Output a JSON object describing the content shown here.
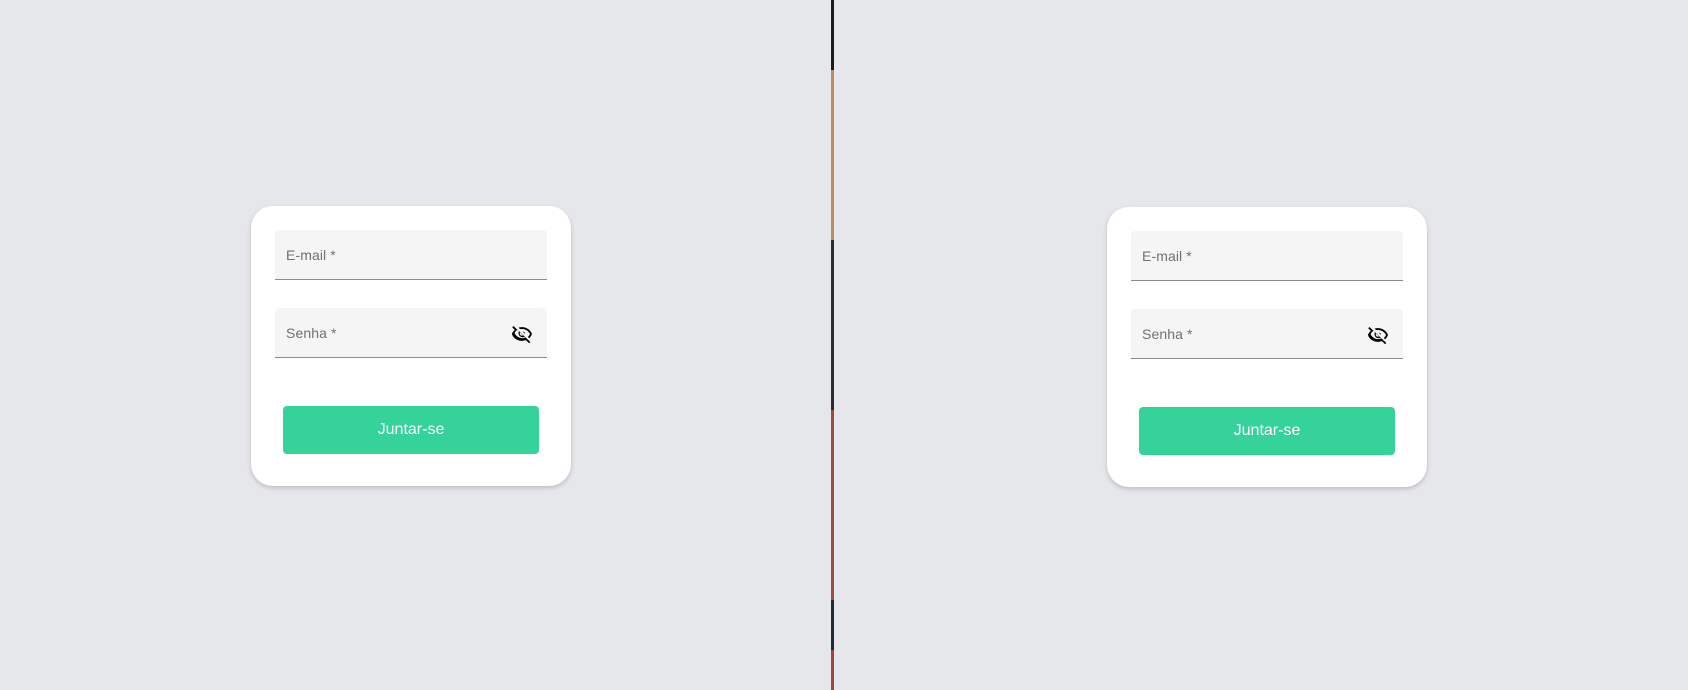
{
  "forms": [
    {
      "email_label": "E-mail *",
      "password_label": "Senha *",
      "password_toggle_icon": "eye-off-icon",
      "submit_label": "Juntar-se"
    },
    {
      "email_label": "E-mail *",
      "password_label": "Senha *",
      "password_toggle_icon": "eye-off-icon",
      "submit_label": "Juntar-se"
    }
  ],
  "colors": {
    "background": "#e6e7eb",
    "card": "#ffffff",
    "field": "#f5f5f5",
    "accent": "#35d399",
    "button_text": "#ffffff"
  }
}
